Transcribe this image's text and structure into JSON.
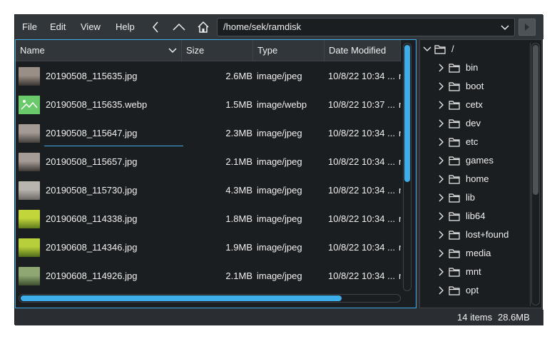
{
  "menu": {
    "file": "File",
    "edit": "Edit",
    "view": "View",
    "help": "Help"
  },
  "toolbar": {
    "back_icon": "chevron-left-icon",
    "up_icon": "chevron-up-icon",
    "home_icon": "home-icon",
    "path": "/home/sek/ramdisk",
    "go_icon": "chevron-right-icon"
  },
  "columns": {
    "name": "Name",
    "size": "Size",
    "type": "Type",
    "date": "Date Modified"
  },
  "files": [
    {
      "name": "20190508_115635.jpg",
      "size": "2.6MB",
      "type": "image/jpeg",
      "date": "10/8/22 10:34 ...",
      "extra": "r",
      "thumb_colors": [
        "#9a8f86",
        "#3b3633"
      ]
    },
    {
      "name": "20190508_115635.webp",
      "size": "1.5MB",
      "type": "image/webp",
      "date": "10/8/22 10:37 ...",
      "extra": "r",
      "thumb_colors": [
        "#6ac96a",
        "#3fa34d"
      ]
    },
    {
      "name": "20190508_115647.jpg",
      "size": "2.3MB",
      "type": "image/jpeg",
      "date": "10/8/22 10:34 ...",
      "extra": "r",
      "thumb_colors": [
        "#a49c94",
        "#45403c"
      ]
    },
    {
      "name": "20190508_115657.jpg",
      "size": "2.1MB",
      "type": "image/jpeg",
      "date": "10/8/22 10:34 ...",
      "extra": "r",
      "thumb_colors": [
        "#a59d95",
        "#3d3835"
      ]
    },
    {
      "name": "20190508_115730.jpg",
      "size": "4.3MB",
      "type": "image/jpeg",
      "date": "10/8/22 10:34 ...",
      "extra": "r",
      "thumb_colors": [
        "#b8b4ae",
        "#6d6a66"
      ]
    },
    {
      "name": "20190608_114338.jpg",
      "size": "1.8MB",
      "type": "image/jpeg",
      "date": "10/8/22 10:34 ...",
      "extra": "r",
      "thumb_colors": [
        "#c2d63b",
        "#5e7a1d"
      ]
    },
    {
      "name": "20190608_114346.jpg",
      "size": "1.9MB",
      "type": "image/jpeg",
      "date": "10/8/22 10:34 ...",
      "extra": "r",
      "thumb_colors": [
        "#b7cf3a",
        "#4f6b1a"
      ]
    },
    {
      "name": "20190608_114926.jpg",
      "size": "2.1MB",
      "type": "image/jpeg",
      "date": "10/8/22 10:34 ...",
      "extra": "r",
      "thumb_colors": [
        "#8fa873",
        "#3d4d2f"
      ]
    }
  ],
  "tree": {
    "root": "/",
    "items": [
      "bin",
      "boot",
      "cetx",
      "dev",
      "etc",
      "games",
      "home",
      "lib",
      "lib64",
      "lost+found",
      "media",
      "mnt",
      "opt"
    ]
  },
  "status": {
    "items": "14 items",
    "total_size": "28.6MB"
  },
  "colors": {
    "accent": "#3daee9",
    "background": "#2a2e32",
    "view_background": "#1b1e20",
    "text": "#eff0f1"
  }
}
